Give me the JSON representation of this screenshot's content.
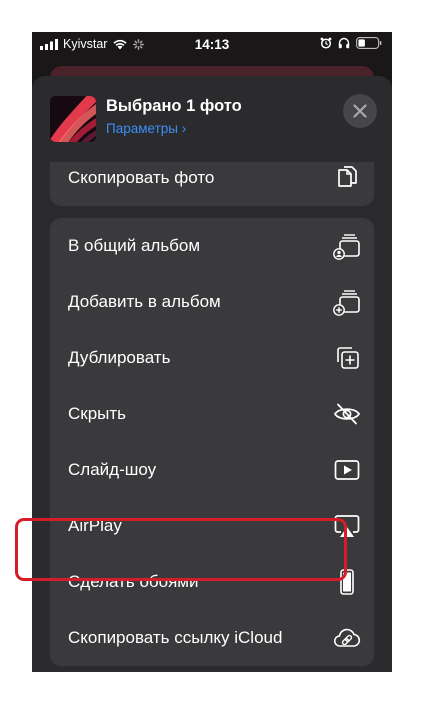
{
  "status": {
    "carrier": "Kyivstar",
    "time": "14:13"
  },
  "header": {
    "title": "Выбрано 1 фото",
    "subtitle": "Параметры",
    "subtitle_chevron": "›"
  },
  "actions_top": [
    {
      "label": "Скопировать фото",
      "icon": "copy-photo-icon"
    }
  ],
  "actions": [
    {
      "label": "В общий альбом",
      "icon": "shared-album-icon"
    },
    {
      "label": "Добавить в альбом",
      "icon": "add-to-album-icon"
    },
    {
      "label": "Дублировать",
      "icon": "duplicate-icon"
    },
    {
      "label": "Скрыть",
      "icon": "hide-eye-icon"
    },
    {
      "label": "Слайд-шоу",
      "icon": "slideshow-icon"
    },
    {
      "label": "AirPlay",
      "icon": "airplay-icon"
    },
    {
      "label": "Сделать обоями",
      "icon": "iphone-icon",
      "highlighted": true
    },
    {
      "label": "Скопировать ссылку iCloud",
      "icon": "icloud-link-icon"
    }
  ],
  "colors": {
    "accent": "#3b8ef5",
    "highlight": "#d51c28",
    "sheet": "#2b2b2d",
    "row": "#3a3a3c"
  }
}
